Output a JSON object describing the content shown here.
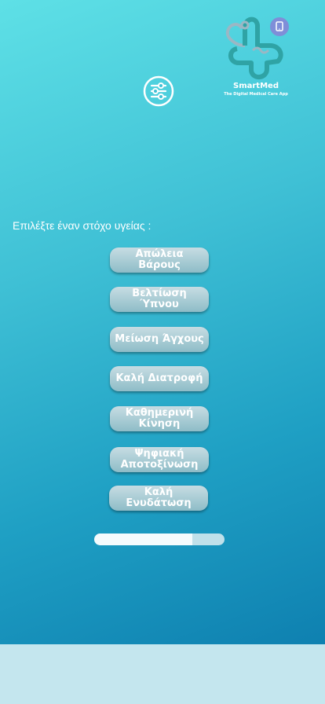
{
  "app": {
    "name": "SmartMed",
    "tagline": "The Digital Medical Care App"
  },
  "settings": {
    "icon": "sliders-icon"
  },
  "prompt": "Επιλέξτε έναν στόχο υγείας :",
  "goals": [
    {
      "label": "Απώλεια Βάρους"
    },
    {
      "label": "Βελτίωση Ύπνου"
    },
    {
      "label": "Μείωση Άγχους"
    },
    {
      "label": "Καλή Διατροφή"
    },
    {
      "label": "Καθημερινή Κίνηση"
    },
    {
      "label": "Ψηφιακή Αποτοξίνωση"
    },
    {
      "label": "Καλή Ενυδάτωση"
    }
  ],
  "progress": {
    "value": 0.75
  },
  "colors": {
    "accent": "#7f8ed8",
    "button": "#a9ccd5"
  }
}
